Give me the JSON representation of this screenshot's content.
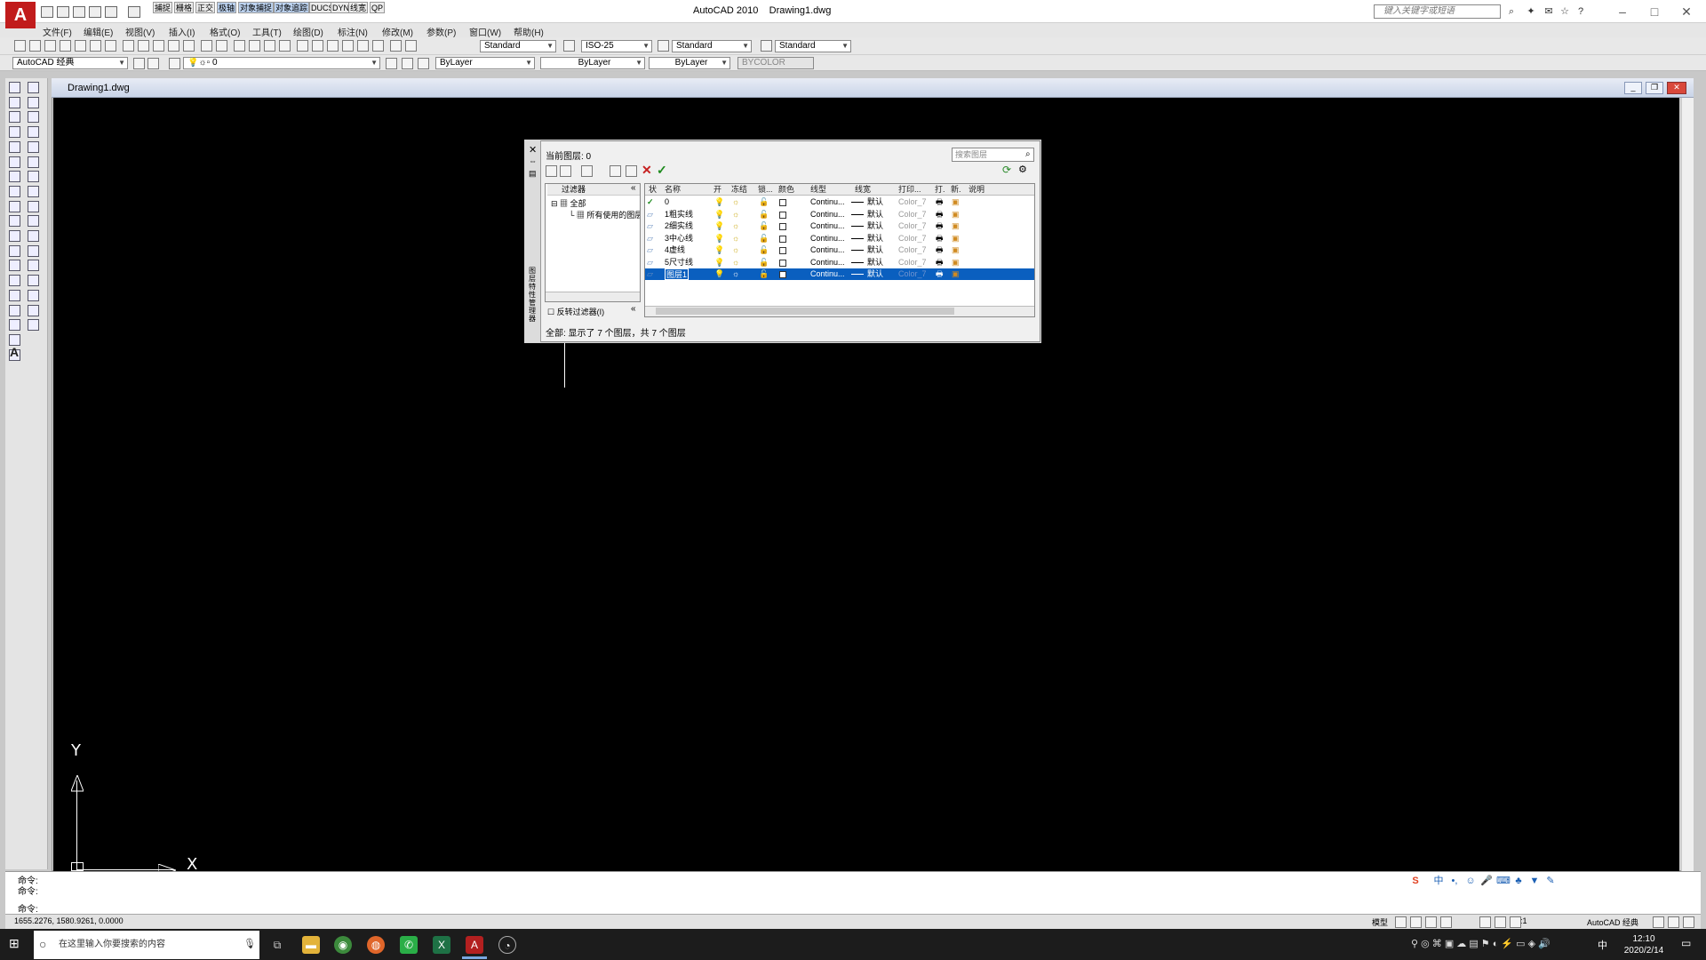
{
  "window": {
    "app_title": "AutoCAD 2010",
    "doc_title": "Drawing1.dwg",
    "search_placeholder": "键入关键字或短语"
  },
  "menu": [
    "文件(F)",
    "编辑(E)",
    "视图(V)",
    "插入(I)",
    "格式(O)",
    "工具(T)",
    "绘图(D)",
    "标注(N)",
    "修改(M)",
    "参数(P)",
    "窗口(W)",
    "帮助(H)"
  ],
  "toolbar1": {
    "text_style": "Standard",
    "dim_style": "ISO-25",
    "table_style": "Standard",
    "mleader_style": "Standard"
  },
  "toolbar2": {
    "workspace": "AutoCAD 经典",
    "layer": "0",
    "color": "ByLayer",
    "linetype": "ByLayer",
    "lineweight": "ByLayer",
    "plotstyle": "BYCOLOR"
  },
  "drawing_window": {
    "title": "Drawing1.dwg"
  },
  "ucs": {
    "y_label": "Y",
    "x_label": "X"
  },
  "layer_manager": {
    "current_layer": "当前图层: 0",
    "search_placeholder": "搜索图层",
    "filters_label": "过滤器",
    "tree_all": "全部",
    "tree_used": "所有使用的图层",
    "invert_filter": "反转过滤器(I)",
    "columns": [
      "状",
      "名称",
      "开",
      "冻结",
      "锁...",
      "颜色",
      "线型",
      "线宽",
      "打印...",
      "打.",
      "新.",
      "说明"
    ],
    "rows": [
      {
        "name": "0",
        "linetype": "Continu...",
        "lineweight": "默认",
        "plotstyle": "Color_7",
        "current": true
      },
      {
        "name": "1粗实线",
        "linetype": "Continu...",
        "lineweight": "默认",
        "plotstyle": "Color_7"
      },
      {
        "name": "2细实线",
        "linetype": "Continu...",
        "lineweight": "默认",
        "plotstyle": "Color_7"
      },
      {
        "name": "3中心线",
        "linetype": "Continu...",
        "lineweight": "默认",
        "plotstyle": "Color_7"
      },
      {
        "name": "4虚线",
        "linetype": "Continu...",
        "lineweight": "默认",
        "plotstyle": "Color_7"
      },
      {
        "name": "5尺寸线",
        "linetype": "Continu...",
        "lineweight": "默认",
        "plotstyle": "Color_7"
      },
      {
        "name": "图层1",
        "linetype": "Continu...",
        "lineweight": "默认",
        "plotstyle": "Color_7",
        "selected": true
      }
    ],
    "status": "全部: 显示了 7 个图层，共 7 个图层",
    "side_title": "图层特性管理器"
  },
  "command": {
    "line1": "命令:",
    "line2": "命令:",
    "prompt": "命令:"
  },
  "statusbar": {
    "coords": "1655.2276, 1580.9261, 0.0000",
    "buttons": [
      "捕捉",
      "栅格",
      "正交",
      "极轴",
      "对象捕捉",
      "对象追踪",
      "DUCS",
      "DYN",
      "线宽",
      "QP"
    ],
    "active_buttons": [
      "极轴",
      "对象捕捉",
      "对象追踪"
    ],
    "right_items": [
      "模型",
      "1:1",
      "AutoCAD 经典"
    ]
  },
  "taskbar": {
    "search_placeholder": "在这里输入你要搜索的内容",
    "time": "12:10",
    "date": "2020/2/14",
    "ime": "中"
  }
}
